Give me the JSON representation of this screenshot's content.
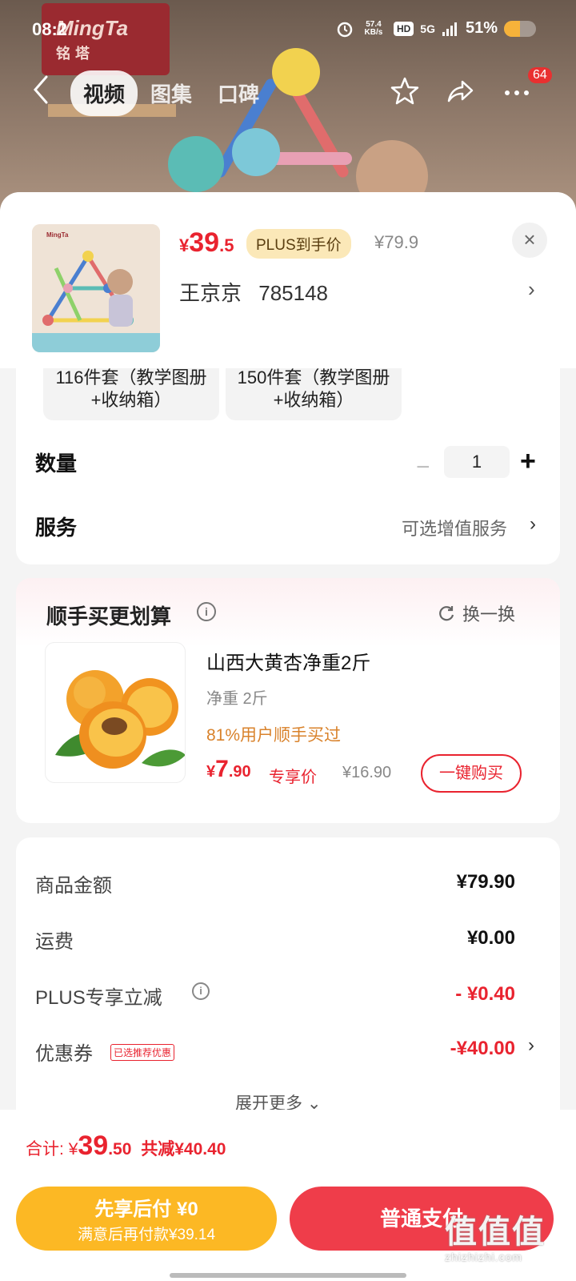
{
  "status_bar": {
    "time": "08:2",
    "net_speed": "57.4 KB/s",
    "signal": "5G",
    "battery": "51%"
  },
  "product_image": {
    "brand_en": "MingTa",
    "brand_cn": "铭塔"
  },
  "nav": {
    "tabs": [
      {
        "label": "视频",
        "active": true
      },
      {
        "label": "图集",
        "active": false
      },
      {
        "label": "口碑",
        "active": false
      }
    ],
    "badge_count": "64"
  },
  "header": {
    "price_currency": "¥",
    "price_int": "39",
    "price_dec": ".5",
    "plus_tag": "PLUS到手价",
    "original_price": "¥79.9",
    "close_symbol": "×",
    "store_name": "王京京",
    "store_id": "785148"
  },
  "options": [
    {
      "label": "116件套（教学图册+收纳箱）"
    },
    {
      "label": "150件套（教学图册+收纳箱）"
    }
  ],
  "quantity": {
    "label": "数量",
    "value": "1",
    "minus": "−",
    "plus": "+"
  },
  "service": {
    "label": "服务",
    "value": "可选增值服务"
  },
  "addon": {
    "title": "顺手买更划算",
    "swap_label": "换一换",
    "product_name": "山西大黄杏净重2斤",
    "spec": "净重 2斤",
    "stat": "81%用户顺手买过",
    "price_currency": "¥",
    "price_int": "7",
    "price_dec": ".90",
    "price_tag": "专享价",
    "original_price": "¥16.90",
    "buy_label": "一键购买"
  },
  "summary": {
    "rows": [
      {
        "label": "商品金额",
        "value": "¥79.90"
      },
      {
        "label": "运费",
        "value": "¥0.00"
      },
      {
        "label": "PLUS专享立减",
        "value": "- ¥0.40"
      },
      {
        "label": "优惠券",
        "value": "-¥40.00"
      }
    ],
    "coupon_tag": "已选推荐优惠",
    "expand_label": "展开更多"
  },
  "bottom_bar": {
    "total_label": "合计:",
    "total_currency": "¥",
    "total_int": "39",
    "total_dec": ".50",
    "total_saved": "共减¥40.40",
    "later_line1": "先享后付 ¥0",
    "later_line2": "满意后再付款¥39.14",
    "pay_label": "普通支付"
  },
  "watermark": {
    "cn": "值值值",
    "url": "zhizhizhi.com"
  },
  "colors": {
    "accent_red": "#e9232f",
    "plus_gold": "#fbe8b8",
    "pay_later_yellow": "#fcb824",
    "pay_red": "#ef3d4a"
  }
}
